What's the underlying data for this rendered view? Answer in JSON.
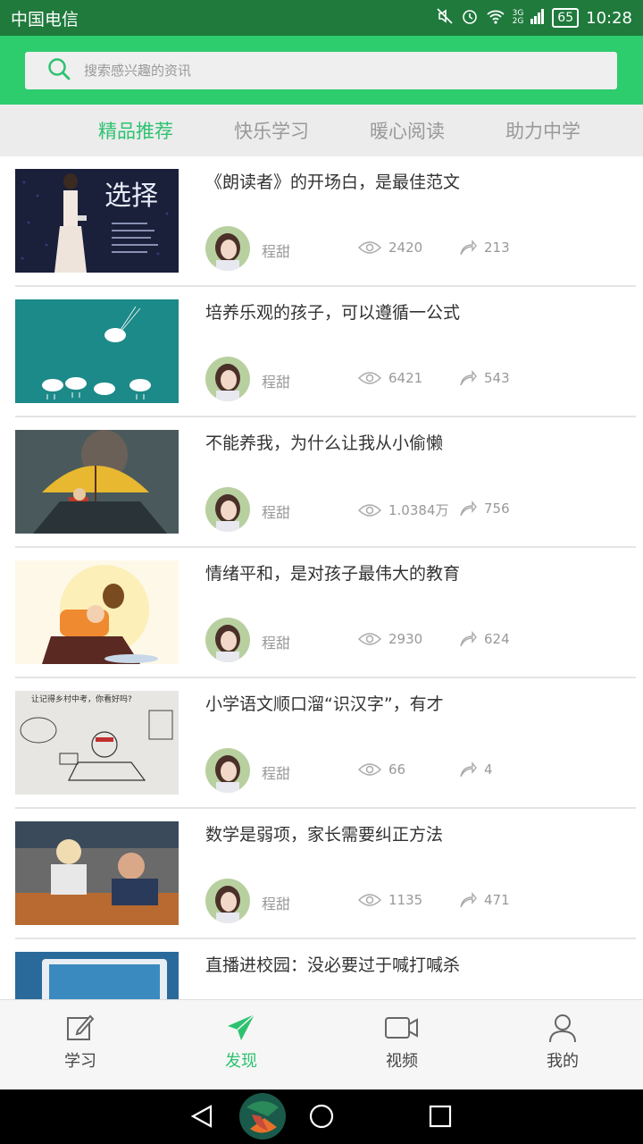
{
  "status": {
    "carrier": "中国电信",
    "battery": "65",
    "net_top": "3G",
    "net_bottom": "2G",
    "time": "10:28"
  },
  "search": {
    "placeholder": "搜索感兴趣的资讯"
  },
  "tabs": [
    {
      "label": "精品推荐",
      "active": true
    },
    {
      "label": "快乐学习",
      "active": false
    },
    {
      "label": "暖心阅读",
      "active": false
    },
    {
      "label": "助力中学",
      "active": false
    }
  ],
  "feed": [
    {
      "title": "《朗读者》的开场白，是最佳范文",
      "author": "程甜",
      "views": "2420",
      "shares": "213"
    },
    {
      "title": "培养乐观的孩子，可以遵循一公式",
      "author": "程甜",
      "views": "6421",
      "shares": "543"
    },
    {
      "title": "不能养我，为什么让我从小偷懒",
      "author": "程甜",
      "views": "1.0384万",
      "shares": "756"
    },
    {
      "title": "情绪平和，是对孩子最伟大的教育",
      "author": "程甜",
      "views": "2930",
      "shares": "624"
    },
    {
      "title": "小学语文顺口溜“识汉字”，有才",
      "author": "程甜",
      "views": "66",
      "shares": "4"
    },
    {
      "title": "数学是弱项，家长需要纠正方法",
      "author": "程甜",
      "views": "1135",
      "shares": "471"
    },
    {
      "title": "直播进校园：没必要过于喊打喊杀",
      "author": "",
      "views": "",
      "shares": ""
    }
  ],
  "thumb_texts": {
    "t1": "选择",
    "t5": "让记得乡村中考，你看好吗?"
  },
  "bottom_nav": [
    {
      "label": "学习",
      "icon": "edit-icon",
      "active": false
    },
    {
      "label": "发现",
      "icon": "paper-plane-icon",
      "active": true
    },
    {
      "label": "视频",
      "icon": "video-camera-icon",
      "active": false
    },
    {
      "label": "我的",
      "icon": "user-icon",
      "active": false
    }
  ],
  "colors": {
    "status_bar": "#1f7a3c",
    "header_green": "#2dcc6d",
    "active_green": "#2dc270"
  }
}
